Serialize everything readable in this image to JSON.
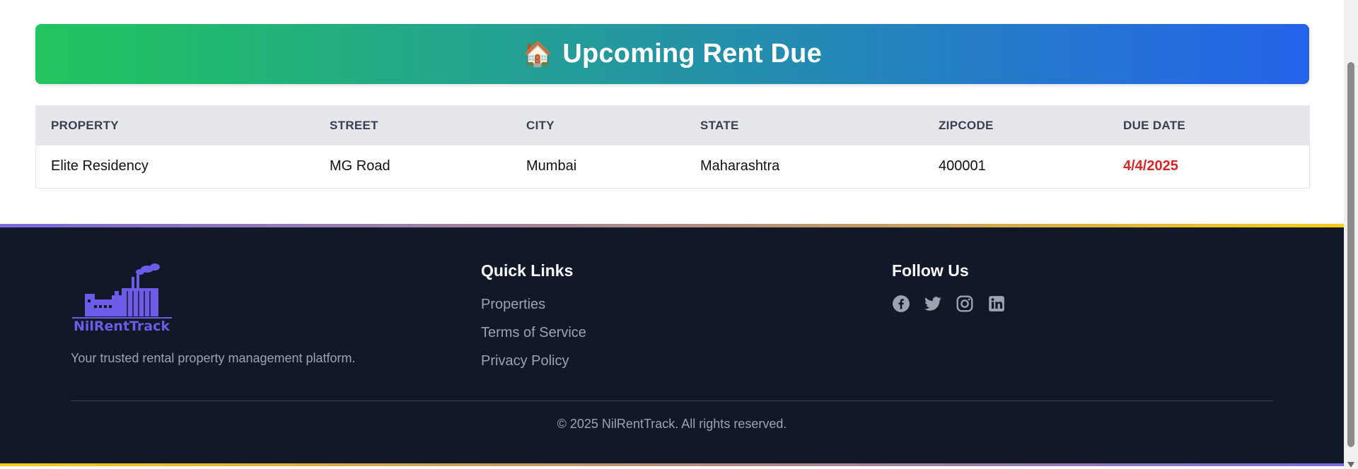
{
  "banner": {
    "icon": "🏠",
    "title": "Upcoming Rent Due"
  },
  "table": {
    "columns": [
      "PROPERTY",
      "STREET",
      "CITY",
      "STATE",
      "ZIPCODE",
      "DUE DATE"
    ],
    "rows": [
      [
        "Elite Residency",
        "MG Road",
        "Mumbai",
        "Maharashtra",
        "400001",
        "4/4/2025"
      ]
    ]
  },
  "colors": {
    "banner_from": "#22c55e",
    "banner_to": "#2563eb",
    "due_date": "#dc2626",
    "footer_bg": "#111827",
    "brand": "#6c5ce7"
  },
  "footer": {
    "brand": "NilRentTrack",
    "tagline": "Your trusted rental property management platform.",
    "quick_links_title": "Quick Links",
    "links": [
      "Properties",
      "Terms of Service",
      "Privacy Policy"
    ],
    "follow_title": "Follow Us",
    "social": [
      "facebook-icon",
      "twitter-icon",
      "instagram-icon",
      "linkedin-icon"
    ],
    "copyright": "© 2025 NilRentTrack. All rights reserved."
  }
}
